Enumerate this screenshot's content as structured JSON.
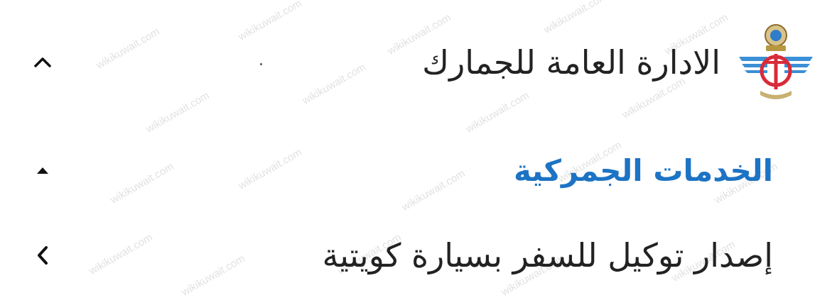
{
  "header": {
    "org_title": "الادارة العامة للجمارك",
    "logo_icon": "customs-emblem-icon",
    "toggle_icon": "chevron-up-icon"
  },
  "section": {
    "title": "الخدمات الجمركية",
    "toggle_icon": "caret-up-icon",
    "accent_color": "#1d73c4"
  },
  "item": {
    "title": "إصدار توكيل للسفر بسيارة كويتية",
    "toggle_icon": "chevron-left-icon"
  },
  "watermark": {
    "text": "wikikuwait.com"
  },
  "colors": {
    "text": "#222222",
    "accent": "#1d73c4",
    "background": "#ffffff"
  }
}
